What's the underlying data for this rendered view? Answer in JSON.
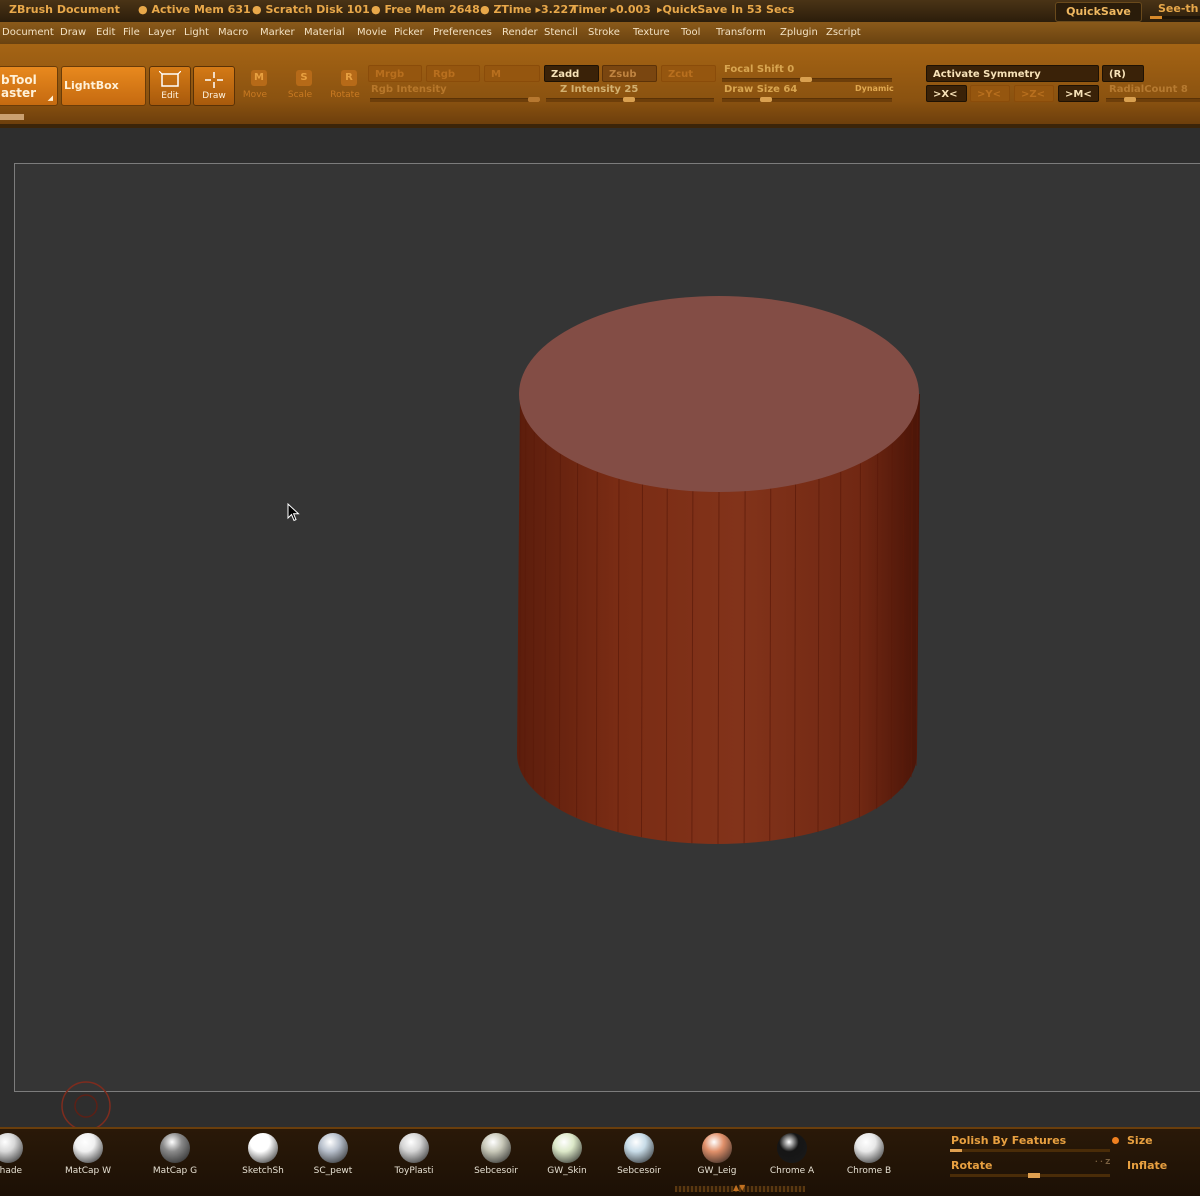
{
  "titlebar": {
    "app_title": "ZBrush Document",
    "active_mem": "Active Mem 631",
    "scratch_disk": "Scratch Disk 101",
    "free_mem": "Free Mem 2648",
    "ztime": "ZTime",
    "ztime_value": "3.227",
    "timer": "Timer",
    "timer_value": "0.003",
    "quicksave_in": "QuickSave In 53 Secs",
    "quicksave_button": "QuickSave",
    "see_through": "See-th"
  },
  "menu": [
    "Document",
    "Draw",
    "Edit",
    "File",
    "Layer",
    "Light",
    "Macro",
    "Marker",
    "Material",
    "Movie",
    "Picker",
    "Preferences",
    "Render",
    "Stencil",
    "Stroke",
    "Texture",
    "Tool",
    "Transform",
    "Zplugin",
    "Zscript"
  ],
  "toolbar": {
    "subtool_line1": "bTool",
    "subtool_line2": "aster",
    "lightbox": "LightBox",
    "edit": "Edit",
    "draw": "Draw",
    "move": "Move",
    "scale": "Scale",
    "rotate": "Rotate",
    "move_glyph": "M",
    "scale_glyph": "S",
    "rotate_glyph": "R",
    "mrgb": "Mrgb",
    "rgb": "Rgb",
    "m": "M",
    "zadd": "Zadd",
    "zsub": "Zsub",
    "zcut": "Zcut",
    "rgb_intensity": "Rgb Intensity",
    "z_intensity": "Z Intensity 25",
    "focal_shift": "Focal Shift 0",
    "draw_size": "Draw Size 64",
    "dynamic": "Dynamic",
    "activate_symmetry": "Activate Symmetry",
    "r_button": "(R)",
    "x_sym": ">X<",
    "y_sym": ">Y<",
    "z_sym": ">Z<",
    "m_sym": ">M<",
    "radial_count": "RadialCount 8"
  },
  "materials": [
    {
      "label": "Shade",
      "color": "#d8d8d8"
    },
    {
      "label": "MatCap W",
      "color": "#f0f0f0"
    },
    {
      "label": "MatCap G",
      "color": "#8a8a8a"
    },
    {
      "label": "SketchSh",
      "color": "#ffffff"
    },
    {
      "label": "SC_pewt",
      "color": "#b8c0cc"
    },
    {
      "label": "ToyPlasti",
      "color": "#d4d4d4"
    },
    {
      "label": "Sebcesoir",
      "color": "#c8c8b8"
    },
    {
      "label": "GW_Skin",
      "color": "#dce8c8"
    },
    {
      "label": "Sebcesoir",
      "color": "#c8dce8"
    },
    {
      "label": "GW_Leig",
      "color": "#e0906a"
    },
    {
      "label": "Chrome A",
      "color": "#151515"
    },
    {
      "label": "Chrome B",
      "color": "#e8e8e8"
    }
  ],
  "bottom_panel": {
    "polish": "Polish By Features",
    "size": "Size",
    "rotate": "Rotate",
    "inflate": "Inflate",
    "mini_glyph": "· · Z"
  },
  "colors": {
    "accent": "#c56a10",
    "model": "#7e2e17",
    "model_top": "#834d45",
    "viewport": "#353535"
  }
}
